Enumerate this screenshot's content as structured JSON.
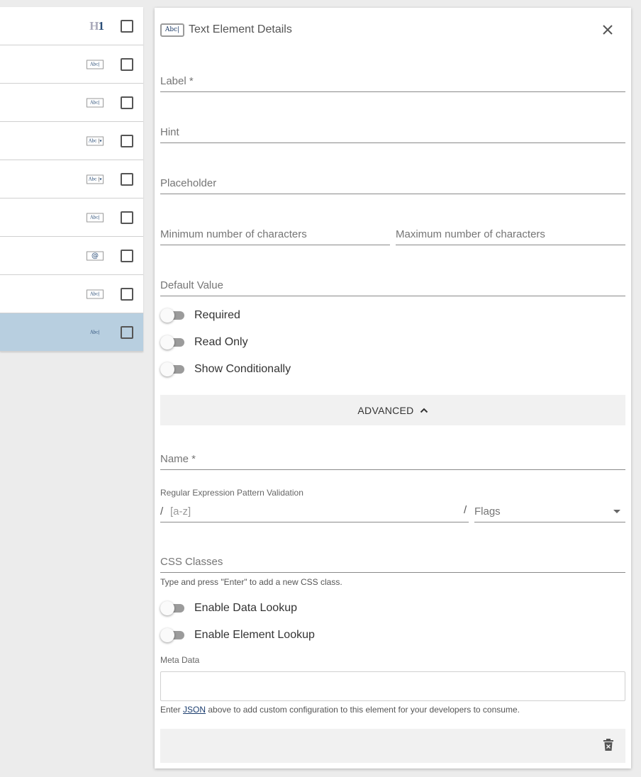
{
  "element_list": {
    "rows": [
      {
        "icon": "heading-h1-icon",
        "h": "H",
        "n": "1",
        "selected": false
      },
      {
        "icon": "text-input-icon",
        "abc": "Abc|",
        "selected": false
      },
      {
        "icon": "text-input-icon",
        "abc": "Abc|",
        "selected": false
      },
      {
        "icon": "select-input-icon",
        "abc": "Abc",
        "selected": false
      },
      {
        "icon": "select-input-icon",
        "abc": "Abc",
        "selected": false
      },
      {
        "icon": "text-input-icon",
        "abc": "Abc|",
        "selected": false
      },
      {
        "icon": "email-input-icon",
        "abc": "@",
        "selected": false
      },
      {
        "icon": "text-input-icon",
        "abc": "Abc|",
        "selected": false
      },
      {
        "icon": "text-input-icon",
        "abc": "Abc|",
        "selected": true
      }
    ]
  },
  "panel": {
    "header_icon_text": "Abc|",
    "title": "Text Element Details",
    "fields": {
      "label": "Label *",
      "hint": "Hint",
      "placeholder": "Placeholder",
      "min_chars": "Minimum number of characters",
      "max_chars": "Maximum number of characters",
      "default_value": "Default Value"
    },
    "toggles": {
      "required": "Required",
      "read_only": "Read Only",
      "show_conditionally": "Show Conditionally"
    },
    "advanced_label": "ADVANCED",
    "advanced": {
      "name_label": "Name *",
      "regex_label": "Regular Expression Pattern Validation",
      "regex_slash": "/",
      "regex_placeholder": "[a-z]",
      "flags_slash": "/",
      "flags_label": "Flags",
      "css_label": "CSS Classes",
      "css_hint": "Type and press \"Enter\" to add a new CSS class.",
      "enable_data_lookup": "Enable Data Lookup",
      "enable_element_lookup": "Enable Element Lookup",
      "meta_label": "Meta Data",
      "meta_hint_pre": "Enter ",
      "meta_hint_link": "JSON",
      "meta_hint_post": " above to add custom configuration to this element for your developers to consume."
    }
  },
  "colors": {
    "selected_row": "#b8cfe0",
    "icon_blue": "#2a4d77",
    "toggle_track": "#9b9b9b"
  }
}
